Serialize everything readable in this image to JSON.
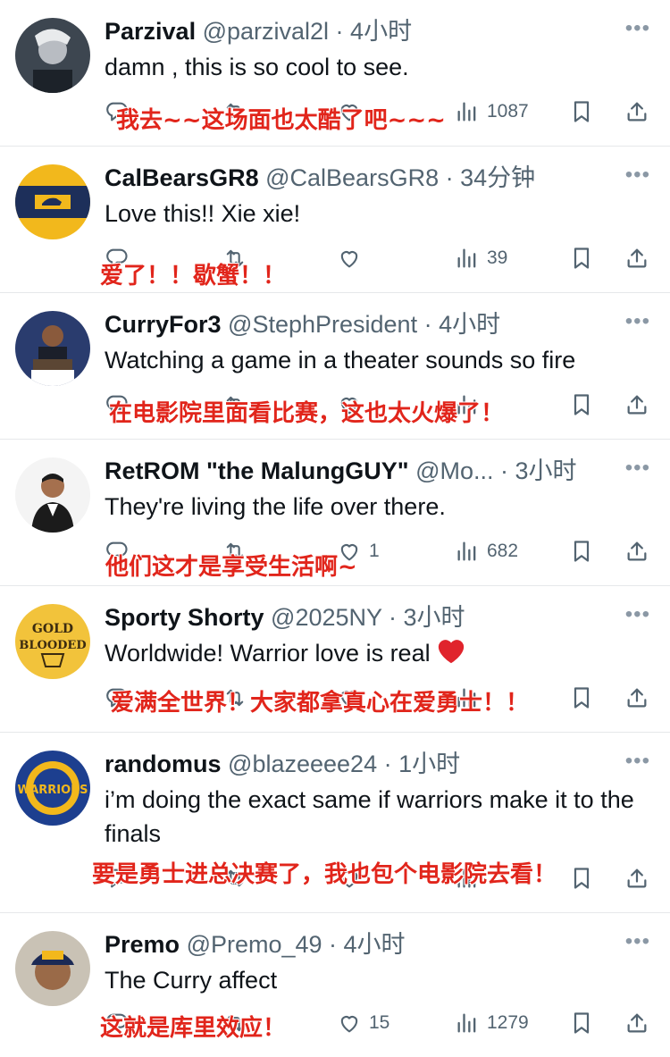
{
  "colors": {
    "overlay": "#e1251b",
    "secondary_text": "#536471",
    "primary_text": "#0f1419",
    "divider": "#e6e8ea"
  },
  "icons": {
    "reply": "reply-icon",
    "retweet": "retweet-icon",
    "like": "heart-icon",
    "views": "views-icon",
    "bookmark": "bookmark-icon",
    "share": "share-icon",
    "more": "more-icon"
  },
  "tweets": [
    {
      "name": "Parzival",
      "meta": "@parzival2l · 4小时",
      "text": "damn , this is so cool to see.",
      "views": "1087",
      "likes": "",
      "overlay": "我去~~这场面也太酷了吧~~~"
    },
    {
      "name": "CalBearsGR8",
      "meta": "@CalBearsGR8 · 34分钟",
      "text": "Love this!! Xie xie!",
      "views": "39",
      "likes": "",
      "overlay": "爱了！！歇蟹！！"
    },
    {
      "name": "CurryFor3",
      "meta": "@StephPresident · 4小时",
      "text": "Watching a game in a theater sounds so fire",
      "views": "",
      "likes": "",
      "overlay": "在电影院里面看比赛，这也太火爆了！"
    },
    {
      "name": "RetROM \"the MalungGUY\"",
      "meta": "@Mo... · 3小时",
      "text": "They're living the life over there.",
      "views": "682",
      "likes": "1",
      "overlay": "他们这才是享受生活啊~"
    },
    {
      "name": "Sporty Shorty",
      "meta": "@2025NY · 3小时",
      "text": "Worldwide! Warrior love is real",
      "views": "",
      "likes": "",
      "overlay": "爱满全世界！大家都拿真心在爱勇士！！"
    },
    {
      "name": "randomus",
      "meta": "@blazeeee24 · 1小时",
      "text": "i’m doing the exact same if warriors make it to the finals",
      "views": "",
      "likes": "",
      "overlay": "要是勇士进总决赛了，我也包个电影院去看！"
    },
    {
      "name": "Premo",
      "meta": "@Premo_49 · 4小时",
      "text": "The Curry affect",
      "views": "1279",
      "likes": "15",
      "overlay": "这就是库里效应！"
    }
  ]
}
